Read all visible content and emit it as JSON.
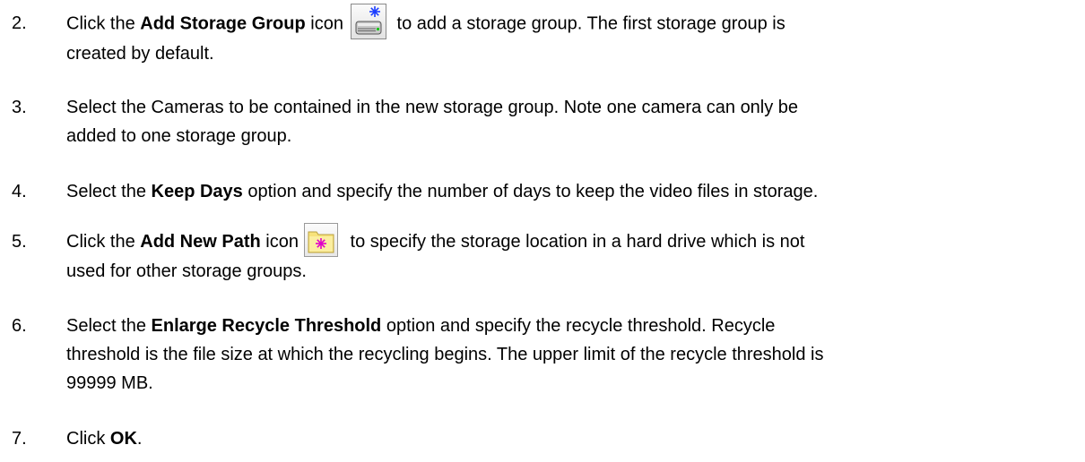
{
  "steps": [
    {
      "number": "2.",
      "pre": "Click the ",
      "bold": "Add Storage Group",
      "mid": " icon",
      "icon": "add-storage-group-icon",
      "post": " to add a storage group. The first storage group is",
      "line2": "created by default."
    },
    {
      "number": "3.",
      "line1": "Select the Cameras to be contained in the new storage group. Note one camera can only be",
      "line2": "added to one storage group."
    },
    {
      "number": "4.",
      "pre": "Select the ",
      "bold": "Keep Days",
      "post": " option and specify the number of days to keep the video files in storage."
    },
    {
      "number": "5.",
      "pre": "Click the ",
      "bold": "Add New Path",
      "mid": " icon",
      "icon": "add-new-path-icon",
      "post": " to specify the storage location in a hard drive which is not",
      "line2": "used for other storage groups."
    },
    {
      "number": "6.",
      "pre": "Select the ",
      "bold": "Enlarge Recycle Threshold",
      "post": " option and specify the recycle threshold. Recycle",
      "line2": "threshold is the file size at which the recycling begins. The upper limit of the recycle threshold is",
      "line3": "99999 MB."
    },
    {
      "number": "7.",
      "pre": "Click ",
      "bold": "OK",
      "post": "."
    }
  ],
  "colors": {
    "text": "#000000",
    "background": "#ffffff",
    "folder_yellow": "#f7e27a",
    "sparkle_magenta": "#e000c8",
    "sparkle_blue": "#1a3cff"
  }
}
